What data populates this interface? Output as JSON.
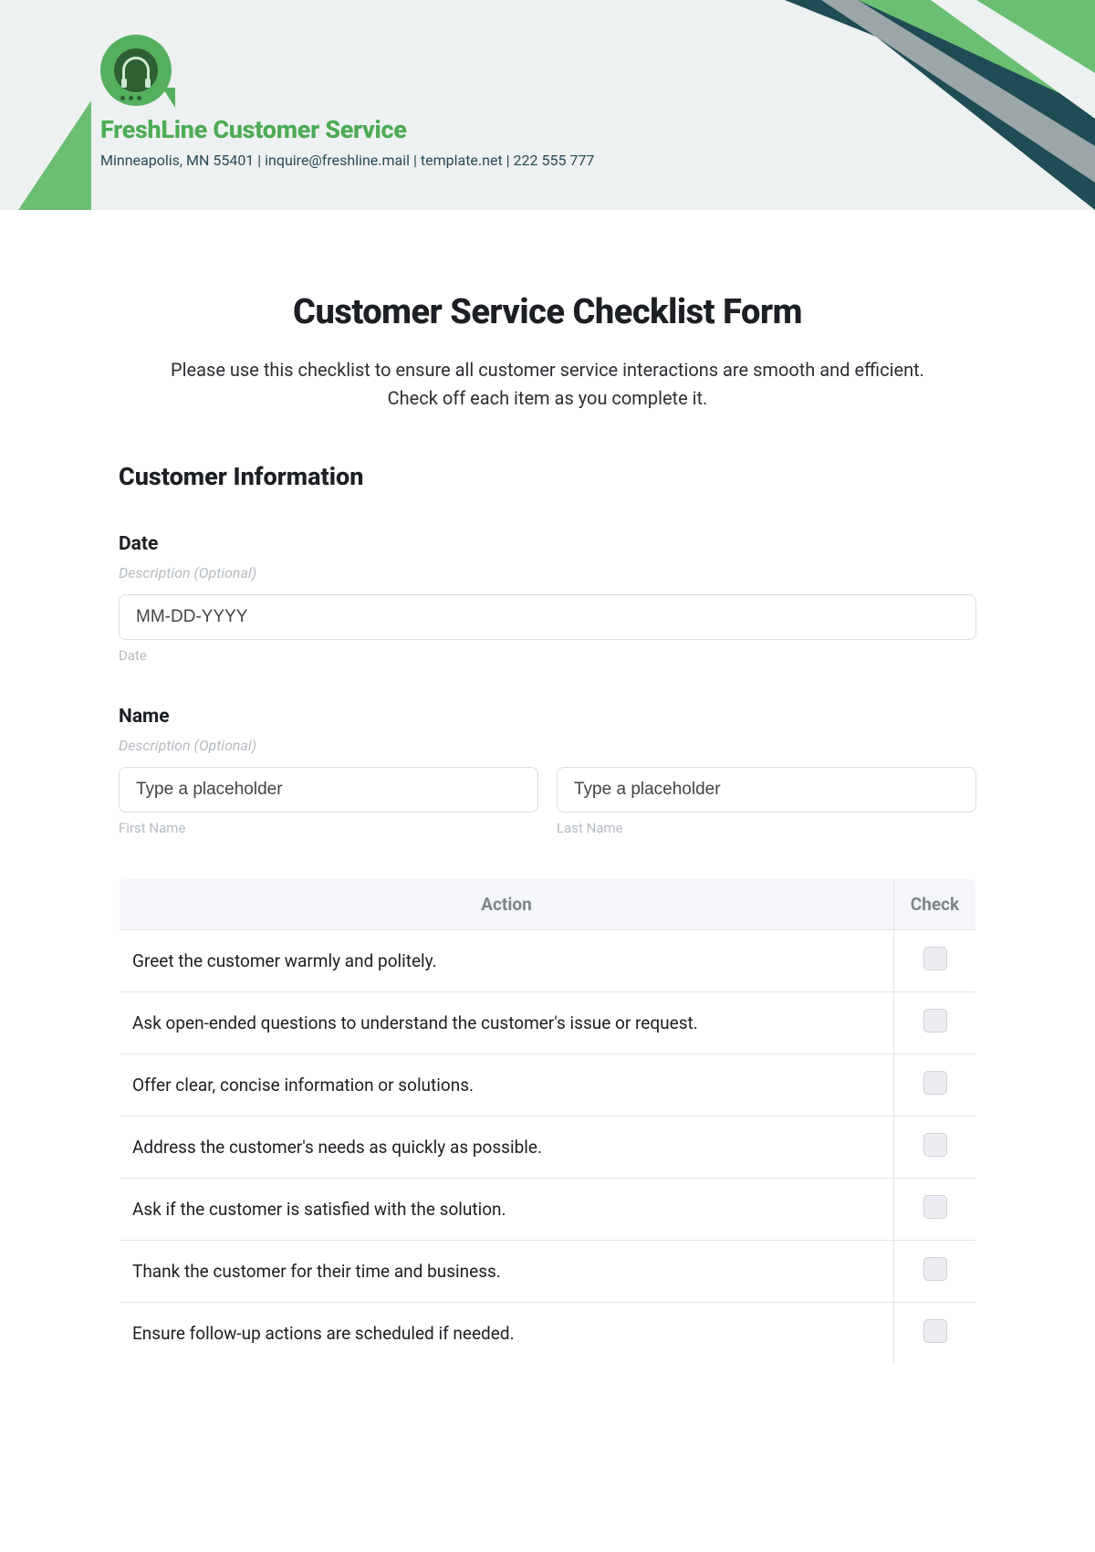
{
  "header": {
    "brand_name": "FreshLine Customer Service",
    "brand_sub": "Minneapolis, MN 55401 | inquire@freshline.mail | template.net | 222 555 777"
  },
  "form": {
    "title": "Customer Service Checklist Form",
    "intro": "Please use this checklist to ensure all customer service interactions are smooth and efficient. Check off each item as you complete it.",
    "section_customer_info": "Customer Information",
    "date": {
      "label": "Date",
      "desc": "Description (Optional)",
      "placeholder": "MM-DD-YYYY",
      "sublabel": "Date"
    },
    "name": {
      "label": "Name",
      "desc": "Description (Optional)",
      "first_placeholder": "Type a placeholder",
      "last_placeholder": "Type a placeholder",
      "first_sub": "First Name",
      "last_sub": "Last Name"
    },
    "table": {
      "action_header": "Action",
      "check_header": "Check",
      "rows": [
        "Greet the customer warmly and politely.",
        "Ask open-ended questions to understand the customer's issue or request.",
        "Offer clear, concise information or solutions.",
        "Address the customer's needs as quickly as possible.",
        "Ask if the customer is satisfied with the solution.",
        "Thank the customer for their time and business.",
        "Ensure follow-up actions are scheduled if needed."
      ]
    }
  }
}
